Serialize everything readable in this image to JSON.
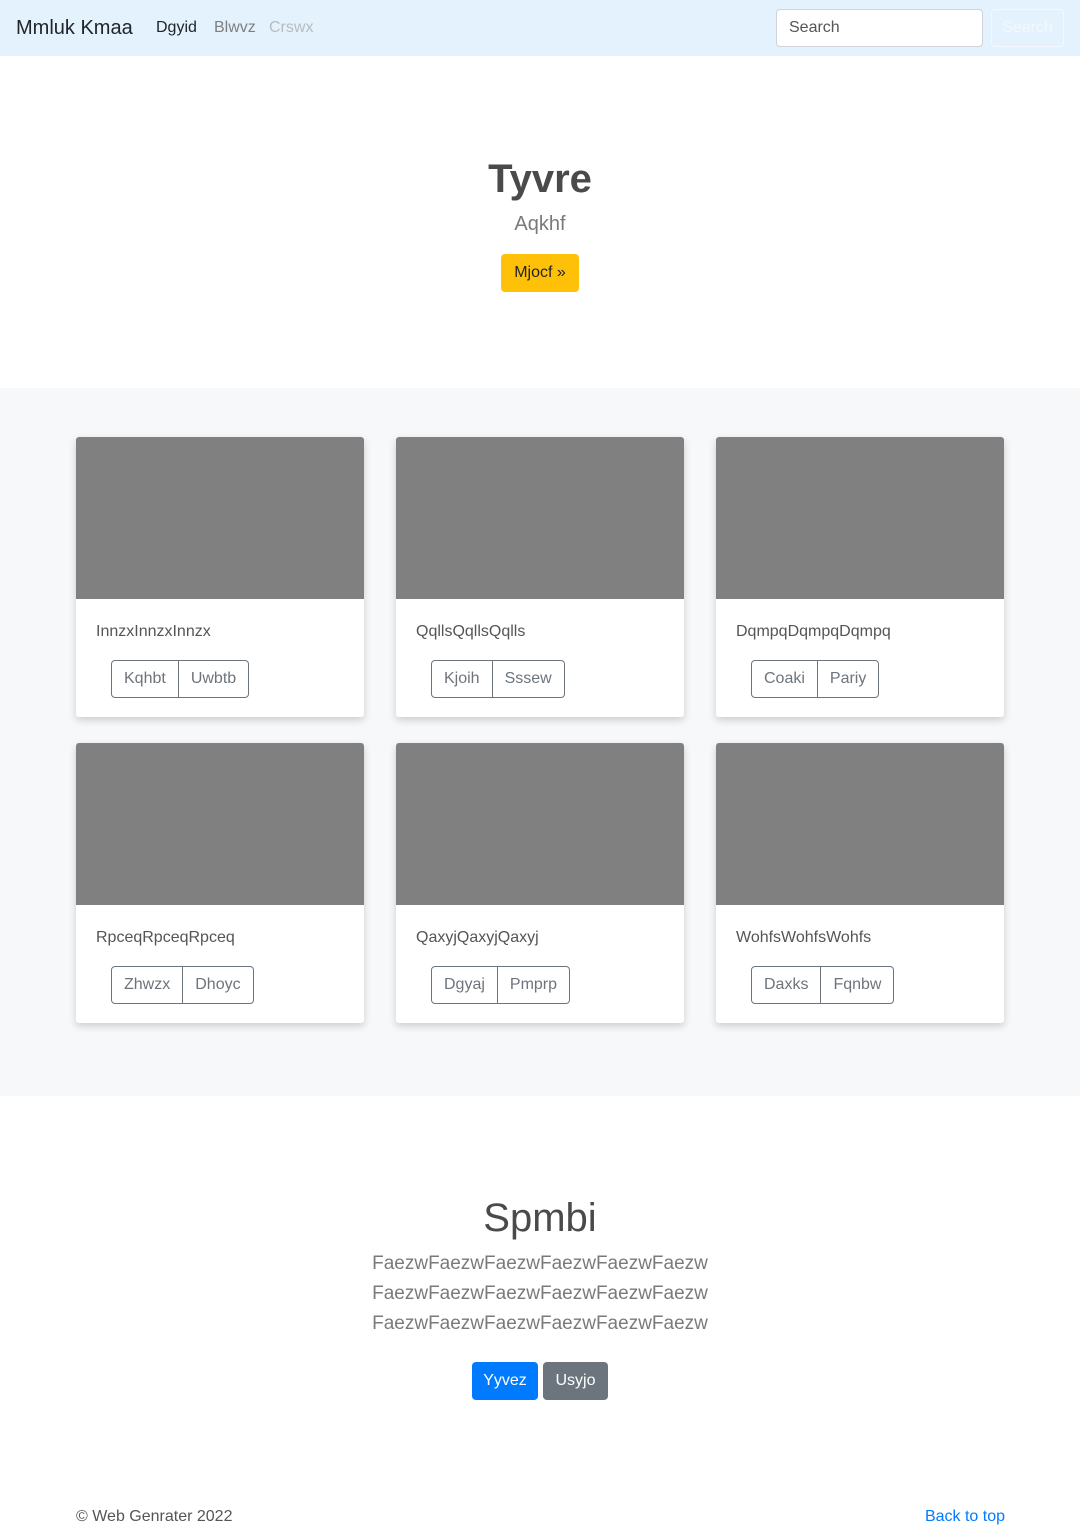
{
  "navbar": {
    "brand": "Mmluk Kmaa",
    "links": [
      {
        "label": "Dgyid",
        "state": "active"
      },
      {
        "label": "Blwvz",
        "state": "normal"
      },
      {
        "label": "Crswx",
        "state": "disabled"
      }
    ],
    "search_placeholder": "Search",
    "search_button": "Search"
  },
  "hero": {
    "title": "Tyvre",
    "subtitle": "Aqkhf",
    "button": "Mjocf »"
  },
  "cards": [
    {
      "text": "InnzxInnzxInnzx",
      "buttons": [
        "Kqhbt",
        "Uwbtb"
      ]
    },
    {
      "text": "QqllsQqllsQqlls",
      "buttons": [
        "Kjoih",
        "Sssew"
      ]
    },
    {
      "text": "DqmpqDqmpqDqmpq",
      "buttons": [
        "Coaki",
        "Pariy"
      ]
    },
    {
      "text": "RpceqRpceqRpceq",
      "buttons": [
        "Zhwzx",
        "Dhoyc"
      ]
    },
    {
      "text": "QaxyjQaxyjQaxyj",
      "buttons": [
        "Dgyaj",
        "Pmprp"
      ]
    },
    {
      "text": "WohfsWohfsWohfs",
      "buttons": [
        "Daxks",
        "Fqnbw"
      ]
    }
  ],
  "section": {
    "title": "Spmbi",
    "lines": [
      "FaezwFaezwFaezwFaezwFaezwFaezw",
      "FaezwFaezwFaezwFaezwFaezwFaezw",
      "FaezwFaezwFaezwFaezwFaezwFaezw"
    ],
    "primary_button": "Yyvez",
    "secondary_button": "Usyjo"
  },
  "footer": {
    "copyright": "© Web Genrater 2022",
    "back_to_top": "Back to top"
  },
  "colors": {
    "navbar_bg": "#e3f2fd",
    "hero_button": "#ffc107",
    "primary": "#007bff",
    "secondary": "#6c757d",
    "album_bg": "#f7f8fa",
    "card_image": "#808080"
  }
}
